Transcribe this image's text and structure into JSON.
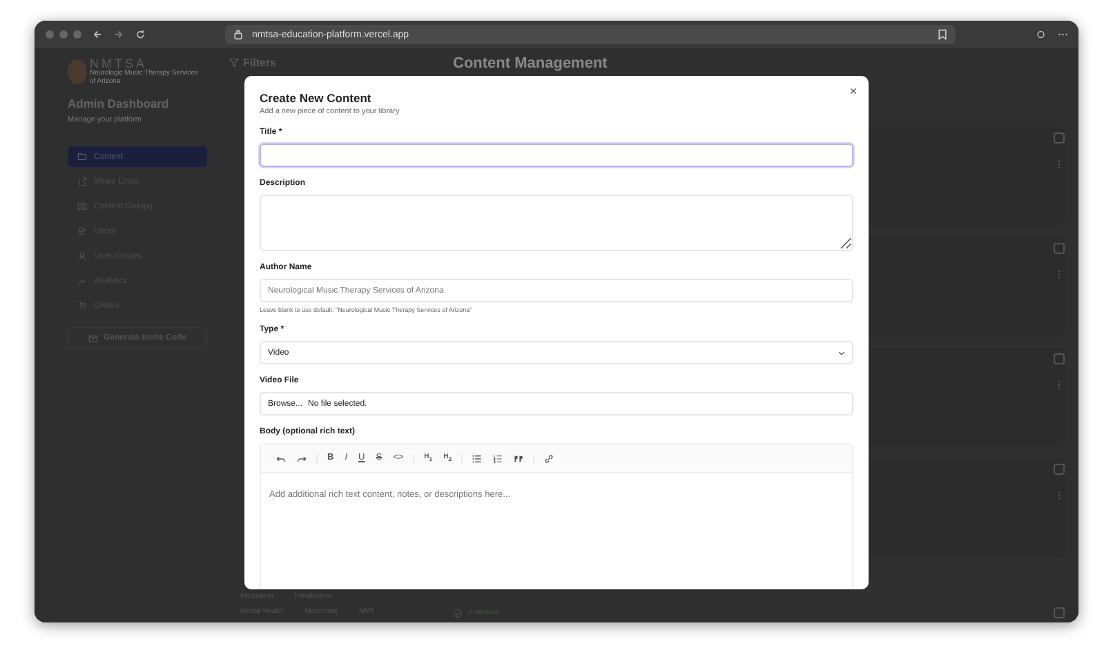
{
  "browser": {
    "url": "nmtsa-education-platform.vercel.app"
  },
  "sidebar": {
    "logo": "NMTSA",
    "logo_sub": "Neurologic Music Therapy Services of Arizona",
    "title": "Admin Dashboard",
    "subtitle": "Manage your platform",
    "items": [
      {
        "label": "Content",
        "selected": true
      },
      {
        "label": "Share Links",
        "selected": false
      },
      {
        "label": "Content Groups",
        "selected": false
      },
      {
        "label": "Users",
        "selected": false
      },
      {
        "label": "User Groups",
        "selected": false
      },
      {
        "label": "Analytics",
        "selected": false
      },
      {
        "label": "Orders",
        "selected": false
      }
    ],
    "invite_button": "Generate Invite Code"
  },
  "filters": {
    "title": "Filters",
    "tags_row_1": [
      "Integration",
      "Introduction"
    ],
    "tags_row_2": [
      "Mental Health",
      "Movement",
      "NMT"
    ]
  },
  "main": {
    "title": "Content Management",
    "rows": [
      {
        "checked": false
      },
      {
        "checked": false
      },
      {
        "checked": false
      },
      {
        "checked": false
      }
    ],
    "last_status": "Published",
    "last_checked": false
  },
  "dialog": {
    "title": "Create New Content",
    "subtitle": "Add a new piece of content to your library",
    "fields": [
      {
        "kind": "input",
        "label": "Title *",
        "focused": true
      },
      {
        "kind": "textarea",
        "label": "Description"
      },
      {
        "kind": "input",
        "label": "Author Name",
        "placeholder": "Neurological Music Therapy Services of Arizona",
        "hint": "Leave blank to use default: \"Neurological Music Therapy Services of Arizona\""
      },
      {
        "kind": "select",
        "label": "Type *",
        "value": "Video"
      },
      {
        "kind": "file",
        "label": "Video File",
        "button": "Browse...",
        "status": "No file selected."
      },
      {
        "kind": "editor",
        "label": "Body (optional rich text)",
        "placeholder": "Add additional rich text content, notes, or descriptions here...",
        "toolbar": [
          [
            {
              "kind": "undo"
            },
            {
              "kind": "redo"
            }
          ],
          [
            {
              "kind": "bold",
              "label": "B"
            },
            {
              "kind": "italic",
              "label": "I"
            },
            {
              "kind": "underline",
              "label": "U"
            },
            {
              "kind": "strike",
              "label": "S"
            },
            {
              "kind": "code",
              "label": "<>"
            }
          ],
          [
            {
              "kind": "heading",
              "label": "H$_{1}$"
            },
            {
              "kind": "heading",
              "label": "H$_{2}$"
            }
          ],
          [
            {
              "kind": "bullets"
            },
            {
              "kind": "numbers"
            },
            {
              "kind": "quote"
            }
          ],
          [
            {
              "kind": "link"
            }
          ]
        ]
      }
    ]
  }
}
